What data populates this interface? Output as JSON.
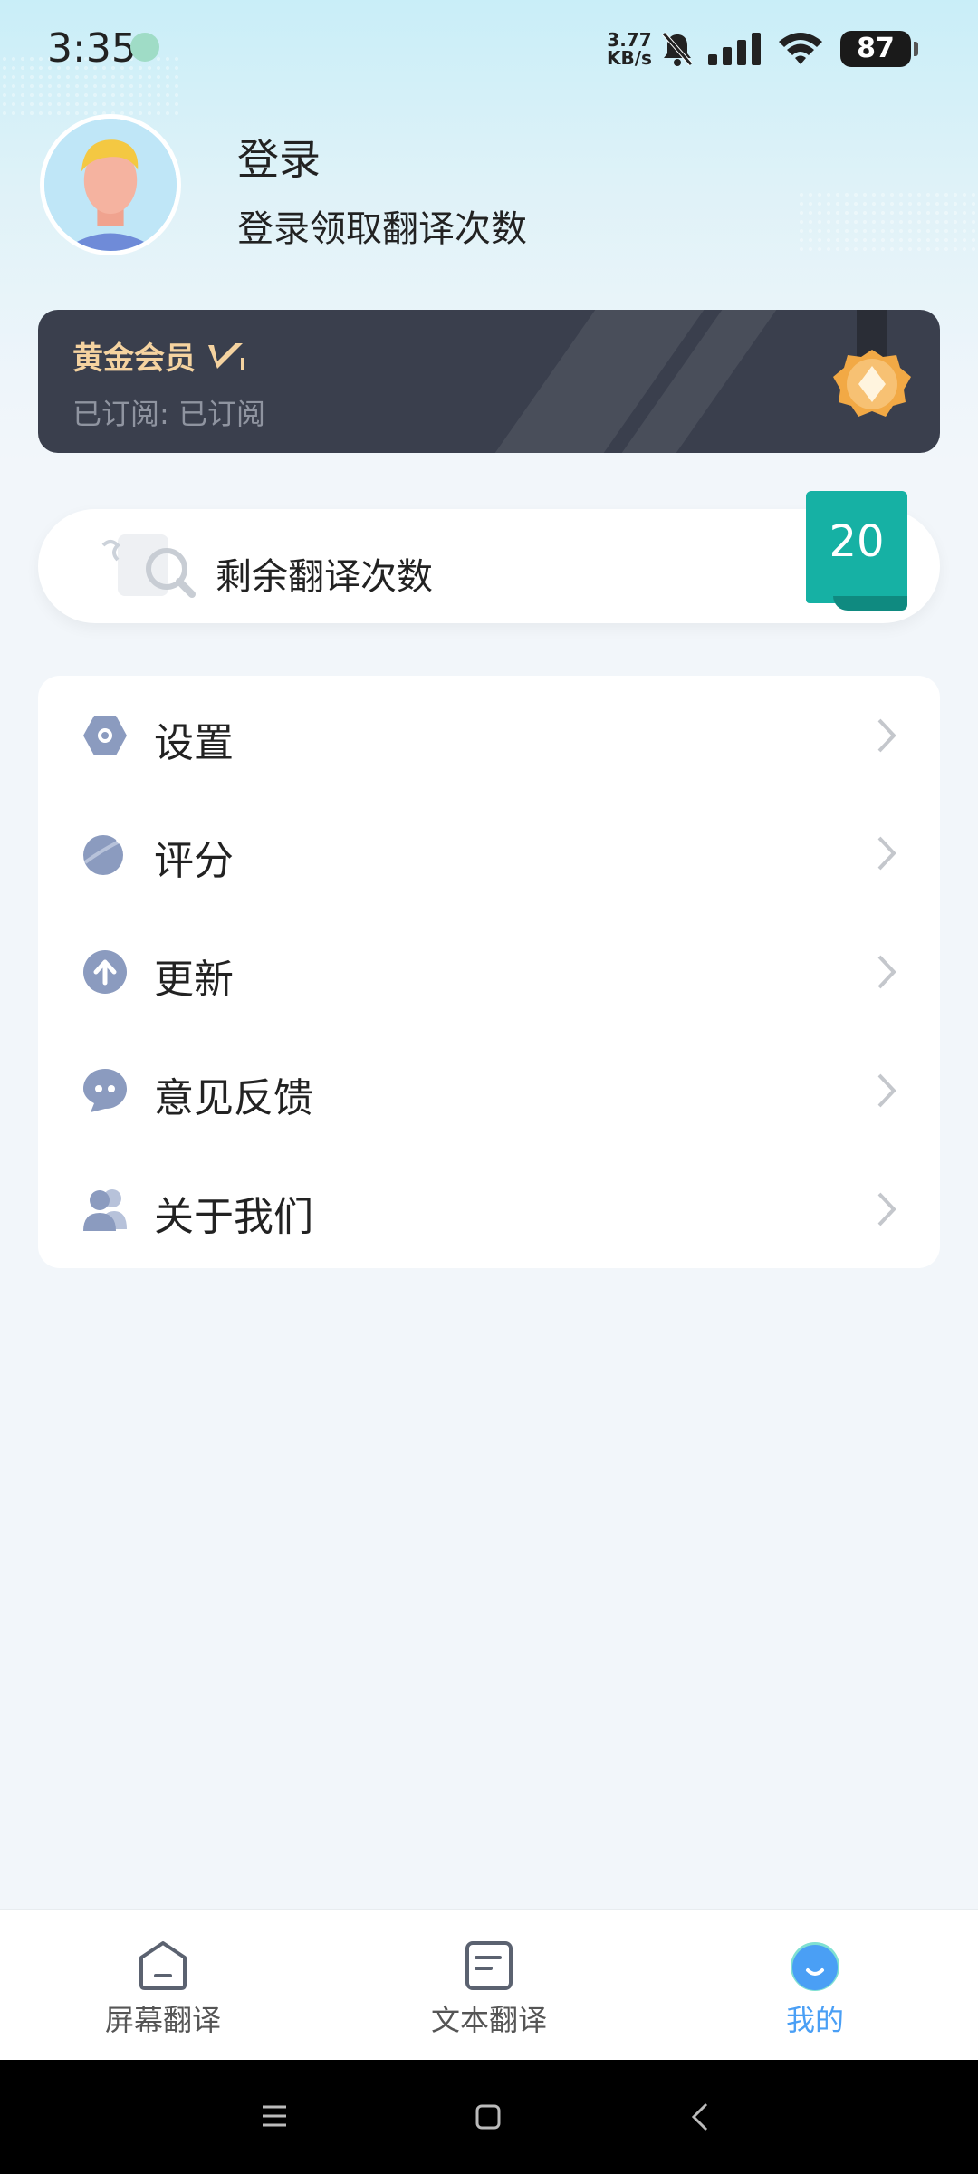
{
  "status_bar": {
    "time": "3:35",
    "net_speed_value": "3.77",
    "net_speed_unit": "KB/s",
    "battery": "87"
  },
  "profile": {
    "login_title": "登录",
    "login_subtitle": "登录领取翻译次数"
  },
  "membership": {
    "title": "黄金会员",
    "subscription_status": "已订阅: 已订阅",
    "colors": {
      "card": "#3a3f4d",
      "title": "#f5d3a0"
    }
  },
  "remaining": {
    "label": "剩余翻译次数",
    "count": "20",
    "tag_color": "#16b1a4"
  },
  "menu": {
    "items": [
      {
        "label": "设置",
        "icon": "settings-hexagon-icon"
      },
      {
        "label": "评分",
        "icon": "rate-planet-icon"
      },
      {
        "label": "更新",
        "icon": "update-arrow-icon"
      },
      {
        "label": "意见反馈",
        "icon": "feedback-chat-icon"
      },
      {
        "label": "关于我们",
        "icon": "about-users-icon"
      }
    ],
    "icon_color": "#8b9bbf"
  },
  "bottom_nav": {
    "items": [
      {
        "label": "屏幕翻译",
        "icon": "screen-translate-icon",
        "active": false
      },
      {
        "label": "文本翻译",
        "icon": "text-translate-icon",
        "active": false
      },
      {
        "label": "我的",
        "icon": "profile-icon",
        "active": true
      }
    ],
    "active_color": "#4a9ff5"
  }
}
